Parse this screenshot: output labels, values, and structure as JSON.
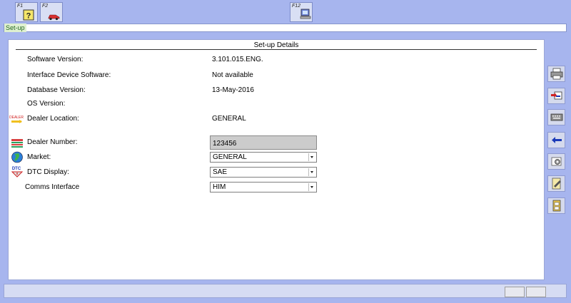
{
  "toolbar": {
    "f1": {
      "label": "F1",
      "icon": "help-question-icon"
    },
    "f2": {
      "label": "F2",
      "icon": "car-icon"
    },
    "f12": {
      "label": "F12",
      "icon": "setup-computer-icon"
    }
  },
  "status": {
    "text": "Set-up"
  },
  "panel": {
    "title": "Set-up Details",
    "rows": {
      "software_version": {
        "label": "Software Version:",
        "value": "3.101.015.ENG."
      },
      "interface_device_software": {
        "label": "Interface Device Software:",
        "value": "Not available"
      },
      "database_version": {
        "label": "Database Version:",
        "value": "13-May-2016"
      },
      "os_version": {
        "label": "OS Version:",
        "value": ""
      },
      "dealer_location": {
        "label": "Dealer Location:",
        "value": "GENERAL"
      },
      "dealer_number": {
        "label": "Dealer Number:",
        "value": "123456"
      },
      "market": {
        "label": "Market:",
        "value": "GENERAL"
      },
      "dtc_display": {
        "label": "DTC Display:",
        "value": "SAE"
      },
      "comms_interface": {
        "label": "Comms Interface",
        "value": "HIM"
      }
    }
  },
  "sidebar": {
    "buttons": [
      "printer-icon",
      "transfer-data-icon",
      "keyboard-icon",
      "back-arrow-icon",
      "settings-tools-icon",
      "edit-notes-icon",
      "document-file-icon"
    ]
  },
  "colors": {
    "background": "#a7b5ee",
    "panel": "#ffffff",
    "readonly_field": "#cccccc"
  }
}
